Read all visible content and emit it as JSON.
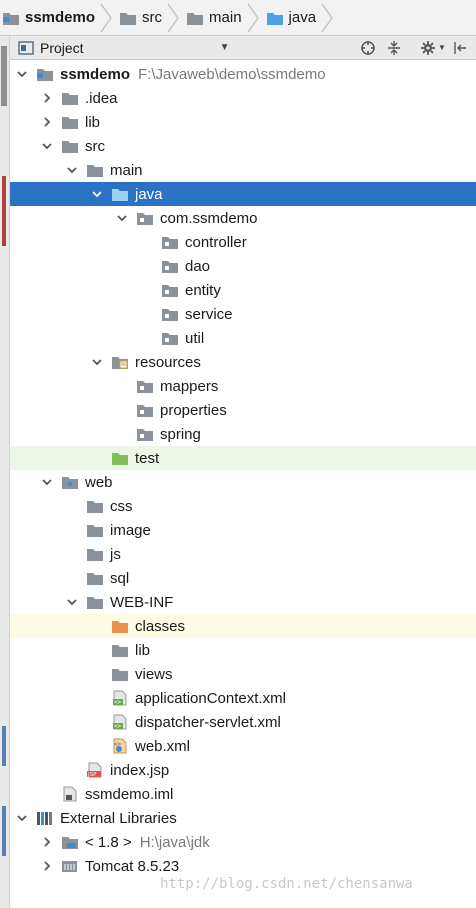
{
  "breadcrumb": [
    {
      "label": "ssmdemo",
      "icon": "module-folder-icon"
    },
    {
      "label": "src",
      "icon": "folder-icon"
    },
    {
      "label": "main",
      "icon": "folder-icon"
    },
    {
      "label": "java",
      "icon": "source-folder-icon"
    }
  ],
  "panel": {
    "title": "Project",
    "dropdown": "▼"
  },
  "tree": [
    {
      "label": "ssmdemo",
      "path": "F:\\Javaweb\\demo\\ssmdemo",
      "icon": "module-folder-icon",
      "depth": 0,
      "expanded": true,
      "bold": true
    },
    {
      "label": ".idea",
      "icon": "folder-icon",
      "depth": 1,
      "expanded": false
    },
    {
      "label": "lib",
      "icon": "folder-icon",
      "depth": 1,
      "expanded": false
    },
    {
      "label": "src",
      "icon": "folder-icon",
      "depth": 1,
      "expanded": true
    },
    {
      "label": "main",
      "icon": "folder-icon",
      "depth": 2,
      "expanded": true
    },
    {
      "label": "java",
      "icon": "source-folder-icon",
      "depth": 3,
      "expanded": true,
      "selected": true
    },
    {
      "label": "com.ssmdemo",
      "icon": "package-icon",
      "depth": 4,
      "expanded": true
    },
    {
      "label": "controller",
      "icon": "package-icon",
      "depth": 5
    },
    {
      "label": "dao",
      "icon": "package-icon",
      "depth": 5
    },
    {
      "label": "entity",
      "icon": "package-icon",
      "depth": 5
    },
    {
      "label": "service",
      "icon": "package-icon",
      "depth": 5
    },
    {
      "label": "util",
      "icon": "package-icon",
      "depth": 5
    },
    {
      "label": "resources",
      "icon": "resources-folder-icon",
      "depth": 3,
      "expanded": true
    },
    {
      "label": "mappers",
      "icon": "package-icon",
      "depth": 4
    },
    {
      "label": "properties",
      "icon": "package-icon",
      "depth": 4
    },
    {
      "label": "spring",
      "icon": "package-icon",
      "depth": 4
    },
    {
      "label": "test",
      "icon": "test-folder-icon",
      "depth": 3,
      "highlight": "green"
    },
    {
      "label": "web",
      "icon": "web-folder-icon",
      "depth": 1,
      "expanded": true
    },
    {
      "label": "css",
      "icon": "folder-icon",
      "depth": 2
    },
    {
      "label": "image",
      "icon": "folder-icon",
      "depth": 2
    },
    {
      "label": "js",
      "icon": "folder-icon",
      "depth": 2
    },
    {
      "label": "sql",
      "icon": "folder-icon",
      "depth": 2
    },
    {
      "label": "WEB-INF",
      "icon": "folder-icon",
      "depth": 2,
      "expanded": true
    },
    {
      "label": "classes",
      "icon": "excluded-folder-icon",
      "depth": 3,
      "highlight": "yellow"
    },
    {
      "label": "lib",
      "icon": "folder-icon",
      "depth": 3
    },
    {
      "label": "views",
      "icon": "folder-icon",
      "depth": 3
    },
    {
      "label": "applicationContext.xml",
      "icon": "spring-xml-icon",
      "depth": 3
    },
    {
      "label": "dispatcher-servlet.xml",
      "icon": "spring-xml-icon",
      "depth": 3
    },
    {
      "label": "web.xml",
      "icon": "web-xml-icon",
      "depth": 3
    },
    {
      "label": "index.jsp",
      "icon": "jsp-file-icon",
      "depth": 2
    },
    {
      "label": "ssmdemo.iml",
      "icon": "iml-file-icon",
      "depth": 1
    },
    {
      "label": "External Libraries",
      "icon": "libraries-icon",
      "depth": 0,
      "expanded": true
    },
    {
      "label": "< 1.8 >",
      "path": "H:\\java\\jdk",
      "icon": "jdk-icon",
      "depth": 1,
      "expanded": false
    },
    {
      "label": "Tomcat 8.5.23",
      "icon": "tomcat-icon",
      "depth": 1,
      "expanded": false
    }
  ],
  "watermark": "http://blog.csdn.net/chensanwa",
  "colors": {
    "selection": "#2a73c4",
    "folder": "#8b9299",
    "source_folder": "#4aa3df",
    "test_folder": "#7fbf5a",
    "excluded_folder": "#e8914a"
  }
}
